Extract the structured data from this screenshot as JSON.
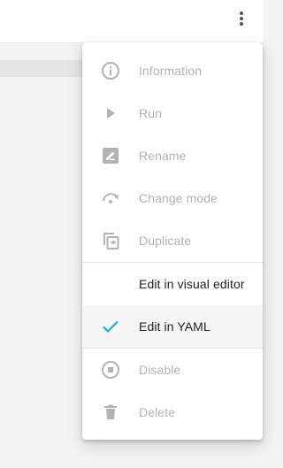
{
  "colors": {
    "icon_disabled": "#b3b3b3",
    "icon_enabled": "#555555",
    "accent_check": "#03a9f4"
  },
  "header": {
    "overflow_icon": "dots-vertical-icon"
  },
  "menu": {
    "items": [
      {
        "label": "Information",
        "icon": "info-circle-icon",
        "disabled": true
      },
      {
        "label": "Run",
        "icon": "play-icon",
        "disabled": true
      },
      {
        "label": "Rename",
        "icon": "rename-icon",
        "disabled": true
      },
      {
        "label": "Change mode",
        "icon": "change-mode-icon",
        "disabled": true
      },
      {
        "label": "Duplicate",
        "icon": "duplicate-icon",
        "disabled": true
      },
      {
        "label": "Edit in visual editor",
        "icon": "",
        "disabled": false
      },
      {
        "label": "Edit in YAML",
        "icon": "check-icon",
        "disabled": false,
        "selected": true
      },
      {
        "label": "Disable",
        "icon": "stop-circle-icon",
        "disabled": true
      },
      {
        "label": "Delete",
        "icon": "delete-icon",
        "disabled": true
      }
    ]
  }
}
